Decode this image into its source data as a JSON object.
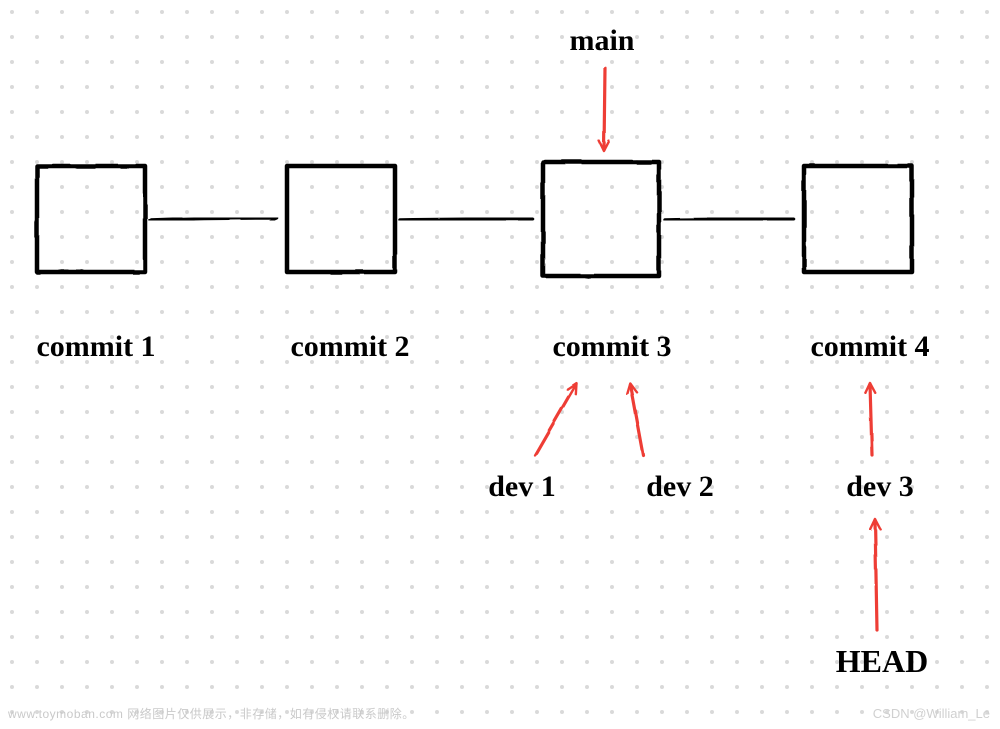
{
  "branches": {
    "main": "main",
    "dev1": "dev 1",
    "dev2": "dev 2",
    "dev3": "dev 3",
    "head": "HEAD"
  },
  "commits": {
    "c1": "commit 1",
    "c2": "commit 2",
    "c3": "commit 3",
    "c4": "commit 4"
  },
  "watermark": "www.toymoban.com 网络图片仅供展示，非存储，如有侵权请联系删除。",
  "credit": "CSDN @William_Le"
}
